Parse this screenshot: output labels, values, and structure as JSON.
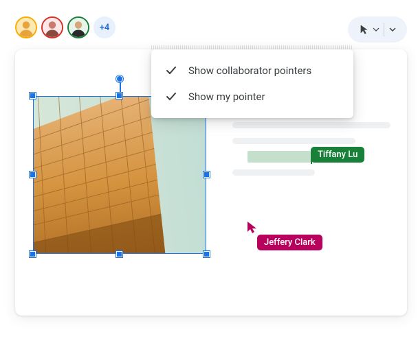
{
  "collaborators": {
    "avatars": [
      {
        "border": "#f9ab00"
      },
      {
        "border": "#d93025"
      },
      {
        "border": "#188038"
      }
    ],
    "overflow_count": "+4"
  },
  "toolbar": {
    "pointer_icon": "pointer-icon"
  },
  "dropdown": {
    "items": [
      {
        "label": "Show collaborator pointers",
        "checked": true
      },
      {
        "label": "Show my pointer",
        "checked": true
      }
    ]
  },
  "collaborator_labels": {
    "tiffany": "Tiffany Lu",
    "jeffery": "Jeffery Clark"
  },
  "colors": {
    "tiffany": "#188038",
    "jeffery": "#b8015c",
    "selection": "#1a73e8"
  }
}
